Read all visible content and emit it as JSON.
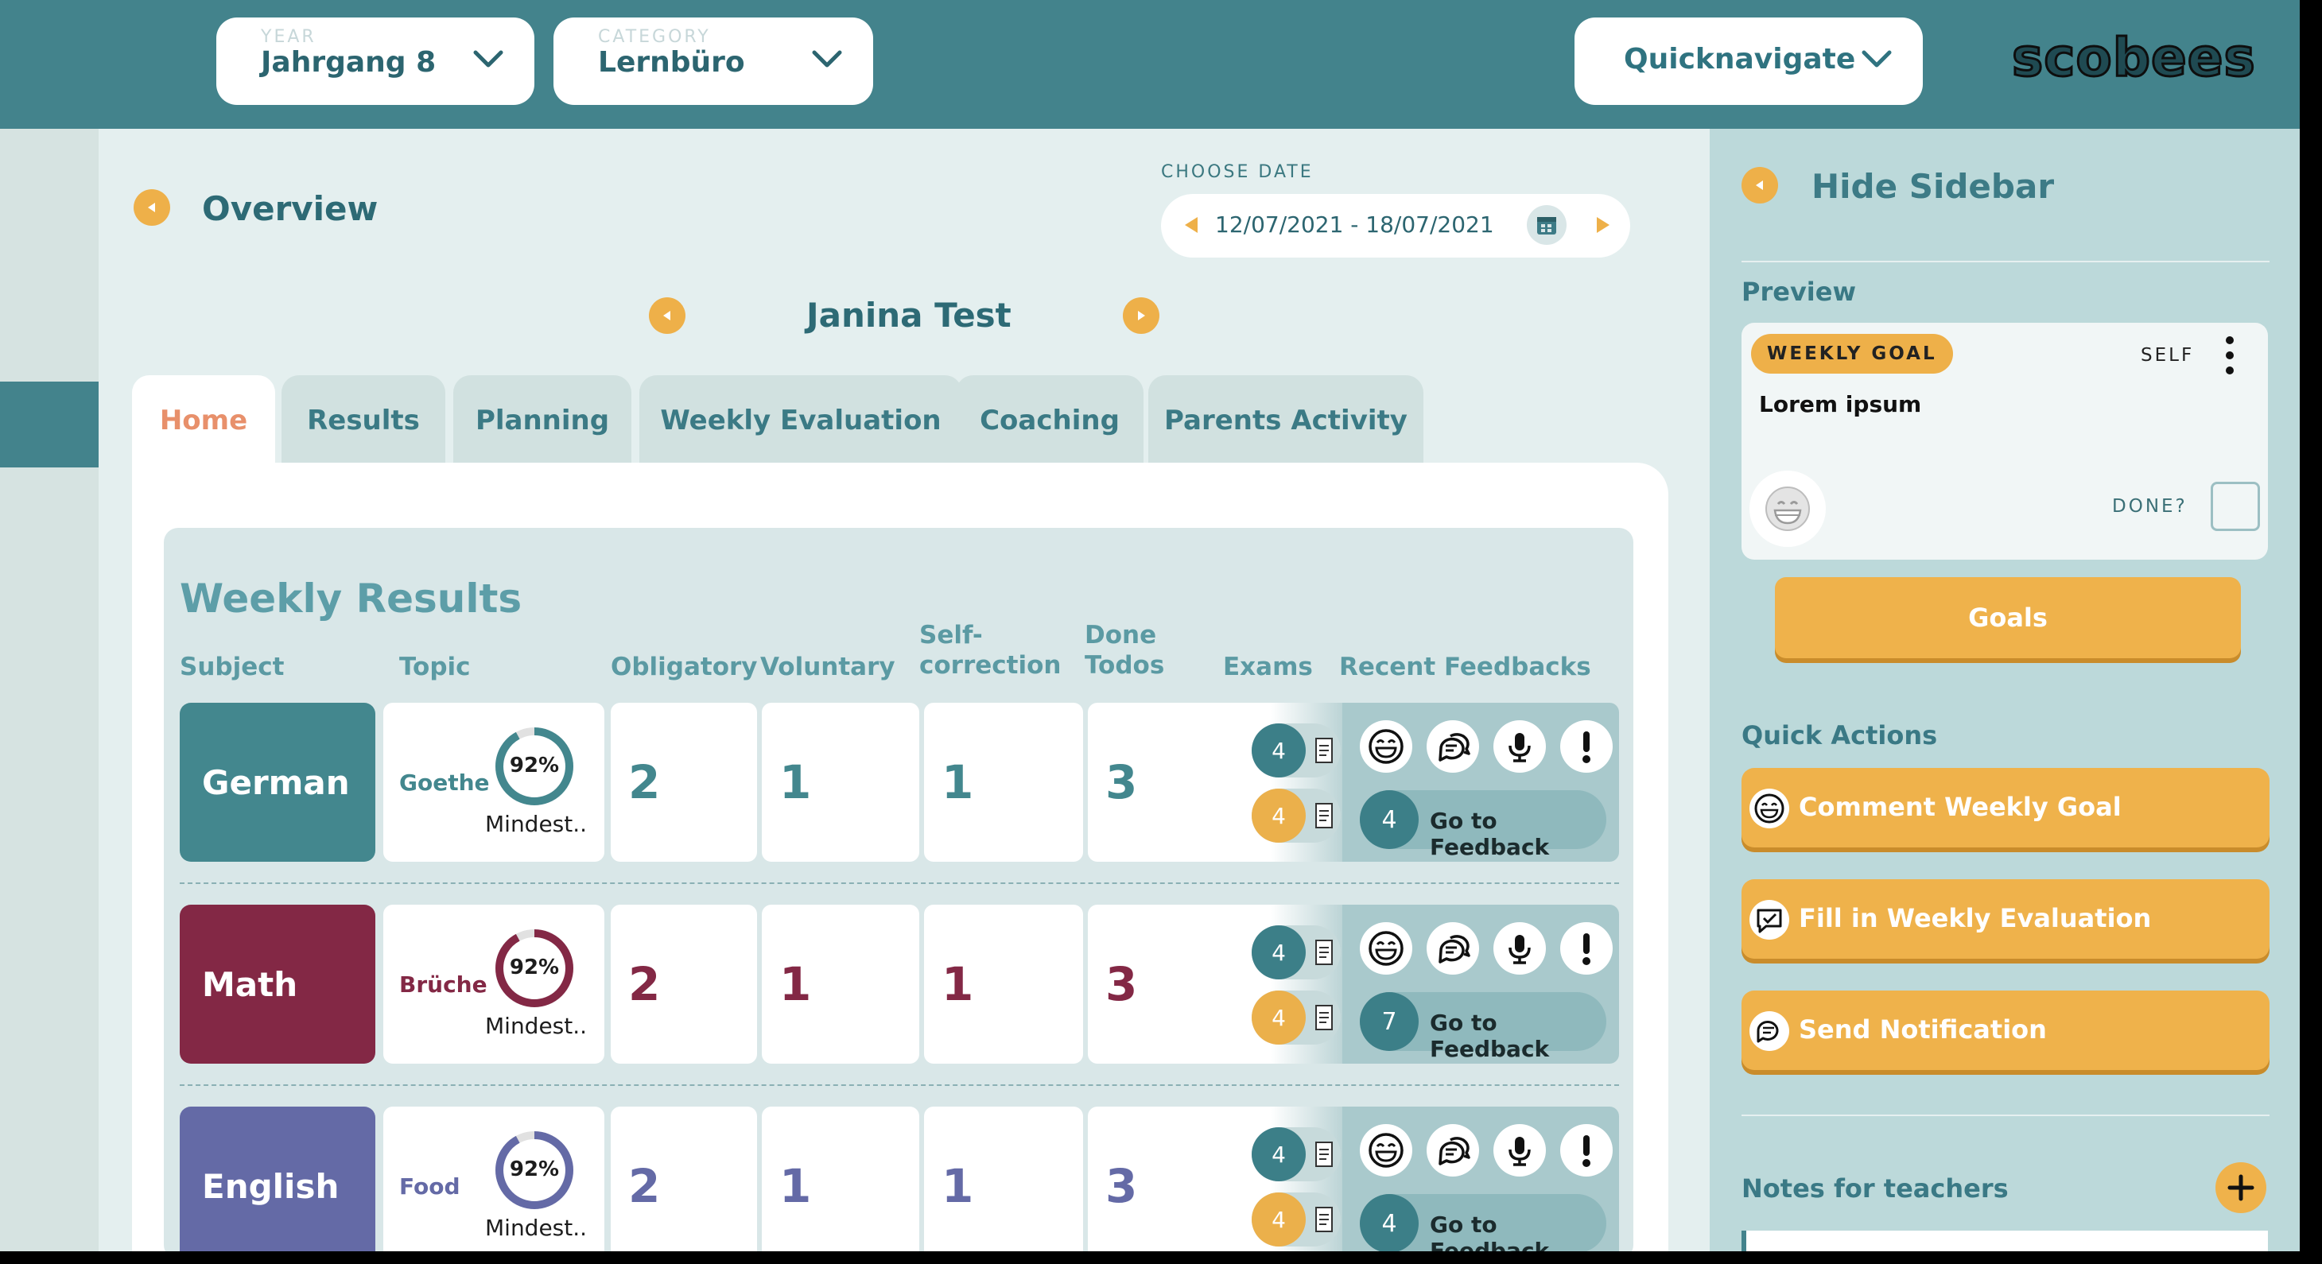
{
  "header": {
    "year": {
      "caption": "YEAR",
      "value": "Jahrgang 8"
    },
    "category": {
      "caption": "CATEGORY",
      "value": "Lernbüro"
    },
    "quicknav": {
      "label": "Quicknavigate"
    },
    "logo": "scobees"
  },
  "main": {
    "overview_label": "Overview",
    "choose_date_label": "CHOOSE DATE",
    "date_range": "12/07/2021 - 18/07/2021",
    "student_name": "Janina Test",
    "tabs": [
      {
        "label": "Home",
        "active": true
      },
      {
        "label": "Results",
        "active": false
      },
      {
        "label": "Planning",
        "active": false
      },
      {
        "label": "Weekly Evaluation",
        "active": false
      },
      {
        "label": "Coaching",
        "active": false
      },
      {
        "label": "Parents Activity",
        "active": false
      }
    ]
  },
  "weekly_results": {
    "title": "Weekly Results",
    "columns": {
      "subject": "Subject",
      "topic": "Topic",
      "obligatory": "Obligatory",
      "voluntary": "Voluntary",
      "selfcorrection_1": "Self-",
      "selfcorrection_2": "correction",
      "done_1": "Done",
      "done_2": "Todos",
      "exams": "Exams",
      "recent_feedbacks": "Recent Feedbacks"
    },
    "rows": [
      {
        "subject": "German",
        "color": "#43878e",
        "topic": "Goethe",
        "percent": "92%",
        "progress": 0.92,
        "level": "Mindest..",
        "obligatory": "2",
        "voluntary": "1",
        "selfcorrection": "1",
        "done_todos": "3",
        "exam_top": "4",
        "exam_bottom": "4",
        "feedback_count": "4",
        "feedback_button": "Go to Feedback"
      },
      {
        "subject": "Math",
        "color": "#832845",
        "topic": "Brüche",
        "percent": "92%",
        "progress": 0.92,
        "level": "Mindest..",
        "obligatory": "2",
        "voluntary": "1",
        "selfcorrection": "1",
        "done_todos": "3",
        "exam_top": "4",
        "exam_bottom": "4",
        "feedback_count": "7",
        "feedback_button": "Go to Feedback"
      },
      {
        "subject": "English",
        "color": "#646aa6",
        "topic": "Food",
        "percent": "92%",
        "progress": 0.92,
        "level": "Mindest..",
        "obligatory": "2",
        "voluntary": "1",
        "selfcorrection": "1",
        "done_todos": "3",
        "exam_top": "4",
        "exam_bottom": "4",
        "feedback_count": "4",
        "feedback_button": "Go to Feedback"
      }
    ]
  },
  "sidebar": {
    "hide_label": "Hide Sidebar",
    "preview_label": "Preview",
    "badge": "WEEKLY GOAL",
    "owner": "SELF",
    "goal_text": "Lorem ipsum",
    "done_label": "DONE?",
    "goals_button": "Goals",
    "quick_actions_label": "Quick Actions",
    "actions": [
      {
        "label": "Comment Weekly Goal",
        "icon": "smiley-icon"
      },
      {
        "label": "Fill in Weekly Evaluation",
        "icon": "chat-check-icon"
      },
      {
        "label": "Send Notification",
        "icon": "chat-bubbles-icon"
      }
    ],
    "notes_label": "Notes for teachers"
  },
  "colors": {
    "header": "#43838c",
    "accent": "#efb24b",
    "active_tab_text": "#e8906b",
    "exam_teal": "#3c7f88",
    "exam_yellow": "#ebb04b"
  }
}
